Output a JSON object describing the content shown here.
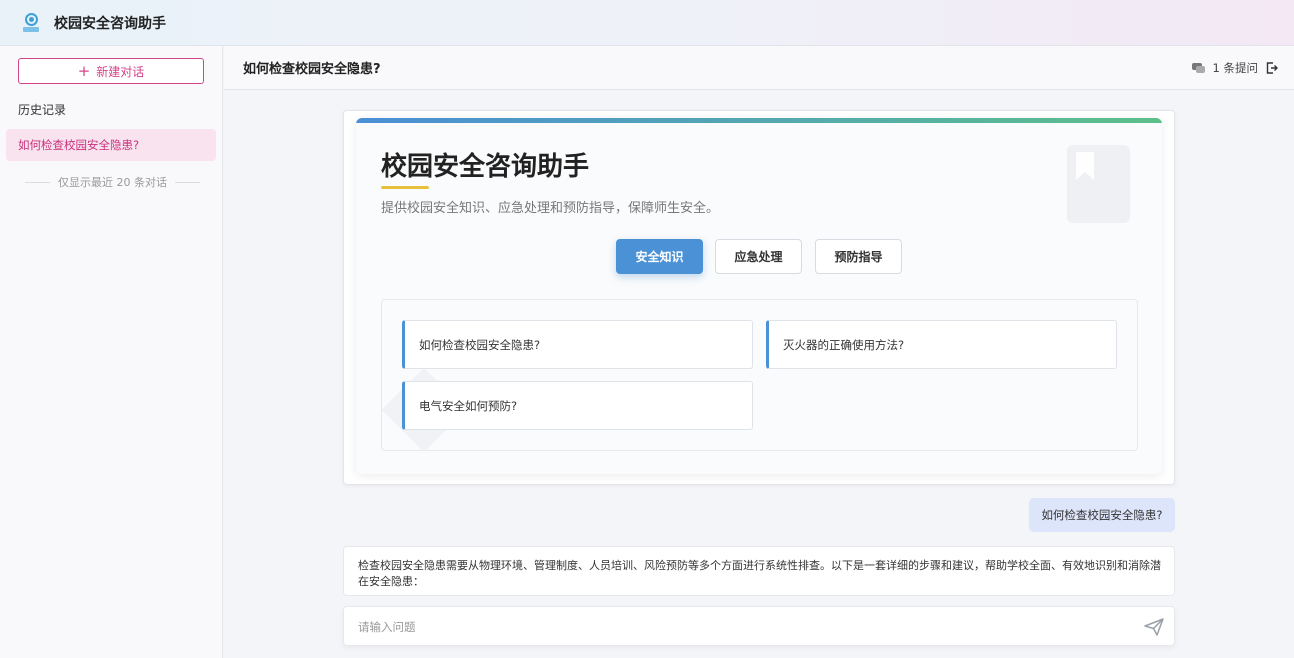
{
  "header": {
    "app_title": "校园安全咨询助手"
  },
  "sidebar": {
    "new_chat_icon": "+",
    "new_chat_label": "新建对话",
    "history_title": "历史记录",
    "history_items": [
      {
        "label": "如何检查校园安全隐患?"
      }
    ],
    "history_note": "仅显示最近 20 条对话"
  },
  "main": {
    "title": "如何检查校园安全隐患?",
    "question_count": "1 条提问",
    "icons": {
      "count": "chat-icon",
      "logout": "logout-icon",
      "send": "send-icon",
      "bookmark": "bookmark-icon"
    }
  },
  "welcome": {
    "title": "校园安全咨询助手",
    "subtitle": "提供校园安全知识、应急处理和预防指导，保障师生安全。",
    "categories": [
      {
        "label": "安全知识",
        "active": true
      },
      {
        "label": "应急处理",
        "active": false
      },
      {
        "label": "预防指导",
        "active": false
      }
    ],
    "questions": [
      {
        "label": "如何检查校园安全隐患?"
      },
      {
        "label": "灭火器的正确使用方法?"
      },
      {
        "label": "电气安全如何预防?"
      }
    ]
  },
  "chat": {
    "user_message": "如何检查校园安全隐患?",
    "answer_text": "检查校园安全隐患需要从物理环境、管理制度、人员培训、风险预防等多个方面进行系统性排查。以下是一套详细的步骤和建议，帮助学校全面、有效地识别和消除潜在安全隐患："
  },
  "input": {
    "placeholder": "请输入问题",
    "value": ""
  },
  "colors": {
    "accent_pink": "#d3458a",
    "accent_blue": "#4b91d6",
    "accent_green": "#5cc08a",
    "underline_yellow": "#e7c13e"
  }
}
